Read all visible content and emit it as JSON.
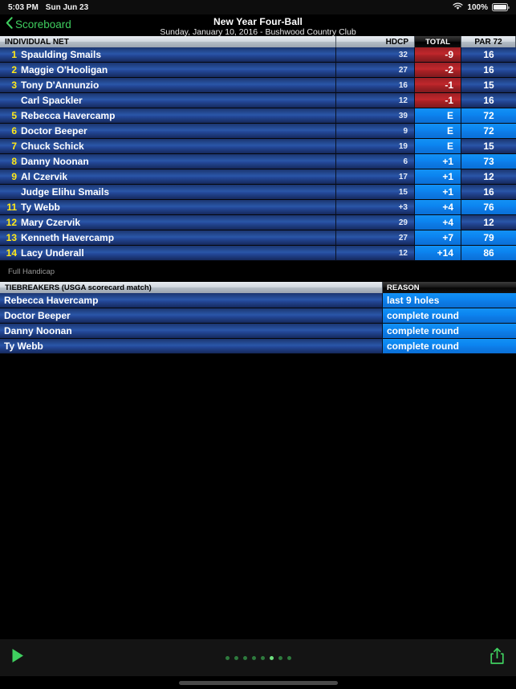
{
  "status_bar": {
    "time": "5:03 PM",
    "date": "Sun Jun 23",
    "battery_percent": "100%",
    "wifi_icon": "wifi-icon",
    "battery_icon": "battery-icon"
  },
  "nav": {
    "back_label": "Scoreboard",
    "back_icon": "chevron-left-icon",
    "title": "New Year Four-Ball",
    "subtitle": "Sunday, January 10, 2016 - Bushwood Country Club"
  },
  "table": {
    "headers": {
      "name": "INDIVIDUAL NET",
      "hdcp": "HDCP",
      "total": "TOTAL",
      "par": "PAR 72"
    },
    "rows": [
      {
        "rank": "1",
        "name": "Spaulding Smails",
        "hdcp": "32",
        "total": "-9",
        "total_state": "under",
        "par": "16",
        "par_state": "partial"
      },
      {
        "rank": "2",
        "name": "Maggie O'Hooligan",
        "hdcp": "27",
        "total": "-2",
        "total_state": "under",
        "par": "16",
        "par_state": "partial"
      },
      {
        "rank": "3",
        "name": "Tony D'Annunzio",
        "hdcp": "16",
        "total": "-1",
        "total_state": "under",
        "par": "15",
        "par_state": "partial"
      },
      {
        "rank": "",
        "name": "Carl Spackler",
        "hdcp": "12",
        "total": "-1",
        "total_state": "under",
        "par": "16",
        "par_state": "partial"
      },
      {
        "rank": "5",
        "name": "Rebecca Havercamp",
        "hdcp": "39",
        "total": "E",
        "total_state": "even",
        "par": "72",
        "par_state": "complete"
      },
      {
        "rank": "6",
        "name": "Doctor Beeper",
        "hdcp": "9",
        "total": "E",
        "total_state": "even",
        "par": "72",
        "par_state": "complete"
      },
      {
        "rank": "7",
        "name": "Chuck Schick",
        "hdcp": "19",
        "total": "E",
        "total_state": "even",
        "par": "15",
        "par_state": "partial"
      },
      {
        "rank": "8",
        "name": "Danny Noonan",
        "hdcp": "6",
        "total": "+1",
        "total_state": "over",
        "par": "73",
        "par_state": "complete"
      },
      {
        "rank": "9",
        "name": "Al Czervik",
        "hdcp": "17",
        "total": "+1",
        "total_state": "over",
        "par": "12",
        "par_state": "partial"
      },
      {
        "rank": "",
        "name": "Judge Elihu Smails",
        "hdcp": "15",
        "total": "+1",
        "total_state": "over",
        "par": "16",
        "par_state": "partial"
      },
      {
        "rank": "11",
        "name": "Ty Webb",
        "hdcp": "+3",
        "total": "+4",
        "total_state": "over",
        "par": "76",
        "par_state": "complete"
      },
      {
        "rank": "12",
        "name": "Mary Czervik",
        "hdcp": "29",
        "total": "+4",
        "total_state": "over",
        "par": "12",
        "par_state": "partial"
      },
      {
        "rank": "13",
        "name": "Kenneth Havercamp",
        "hdcp": "27",
        "total": "+7",
        "total_state": "over",
        "par": "79",
        "par_state": "complete"
      },
      {
        "rank": "14",
        "name": "Lacy Underall",
        "hdcp": "12",
        "total": "+14",
        "total_state": "over",
        "par": "86",
        "par_state": "complete"
      }
    ],
    "footnote": "Full Handicap"
  },
  "tiebreakers": {
    "headers": {
      "name": "TIEBREAKERS (USGA scorecard match)",
      "reason": "REASON"
    },
    "rows": [
      {
        "name": "Rebecca Havercamp",
        "reason": "last 9 holes"
      },
      {
        "name": "Doctor Beeper",
        "reason": "complete round"
      },
      {
        "name": "Danny Noonan",
        "reason": "complete round"
      },
      {
        "name": "Ty Webb",
        "reason": "complete round"
      }
    ]
  },
  "toolbar": {
    "play_icon": "play-icon",
    "share_icon": "share-icon",
    "page_dot_count": 8,
    "page_dot_active_index": 5
  },
  "colors": {
    "accent_green": "#3fcf5f",
    "rank_yellow": "#ffe81a",
    "under_par_red": "#c0272c",
    "score_blue": "#0b84ef",
    "row_navy": "#24499a"
  }
}
